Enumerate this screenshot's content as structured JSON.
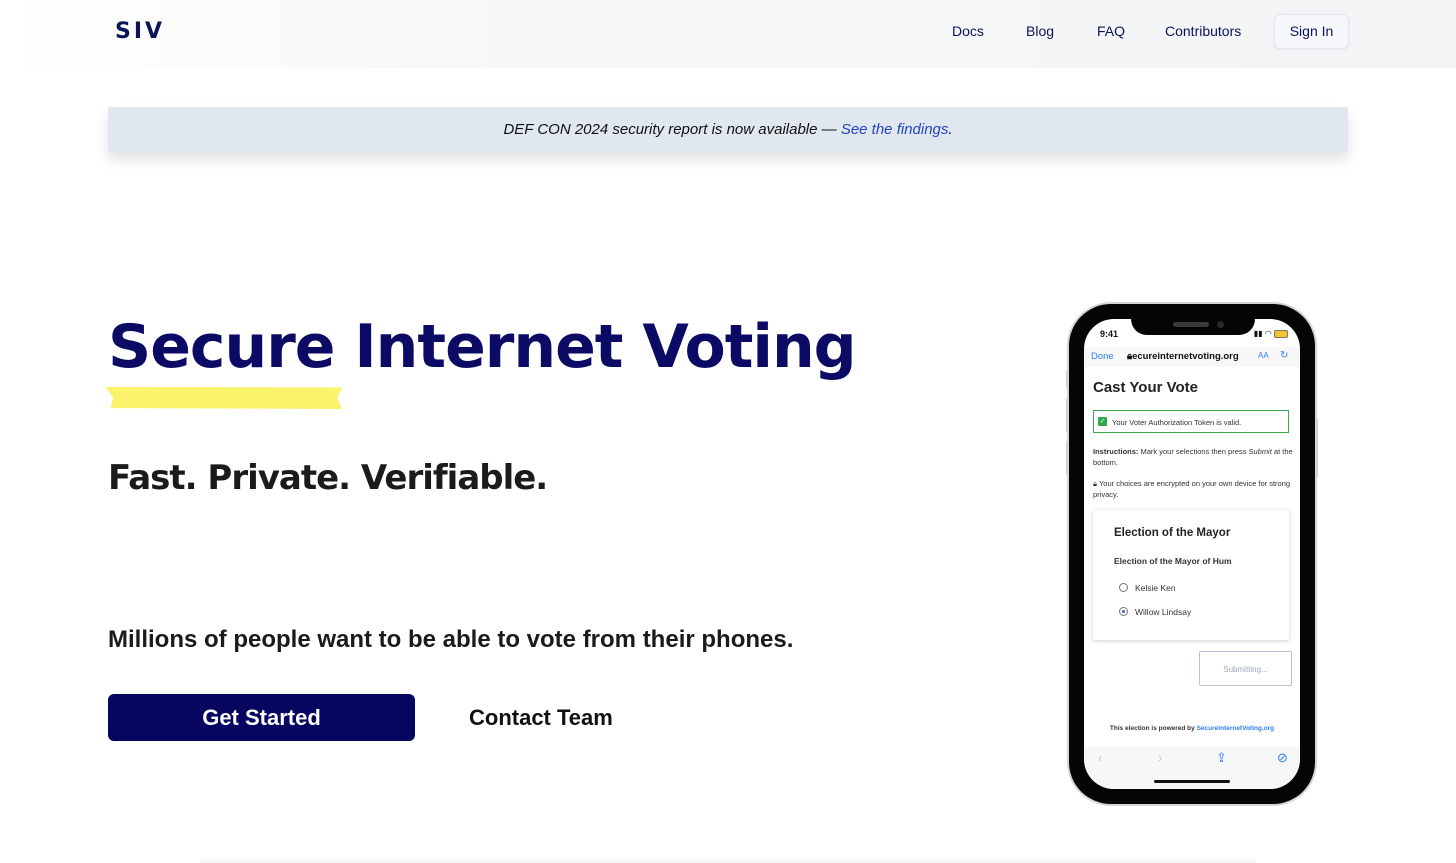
{
  "header": {
    "logo": "SIV",
    "nav": [
      "Docs",
      "Blog",
      "FAQ",
      "Contributors"
    ],
    "sign_in": "Sign In"
  },
  "banner": {
    "text": "DEF CON 2024 security report is now available — ",
    "link": "See the findings",
    "suffix": "."
  },
  "hero": {
    "title": "Secure Internet Voting",
    "tagline": "Fast. Private. Verifiable.",
    "lead": "Millions of people want to be able to vote from their phones.",
    "primary_cta": "Get Started",
    "secondary_cta": "Contact Team"
  },
  "phone": {
    "time": "9:41",
    "url_done": "Done",
    "url": "ecureinternetvoting.org",
    "url_aa": "AA",
    "heading": "Cast Your Vote",
    "token_status": "Your Voter Authorization Token is valid.",
    "instructions_label": "Instructions:",
    "instructions_text": " Mark your selections then press ",
    "instructions_submit": "Submit",
    "instructions_tail": " at the bottom.",
    "privacy_note": "Your choices are encrypted on your own device for strong privacy.",
    "card_title": "Election of the Mayor",
    "card_question": "Election of the Mayor of Hum",
    "options": [
      "Kelsie Ken",
      "Willow Lindsay"
    ],
    "selected_option": "Willow Lindsay",
    "submit_label": "Submitting...",
    "powered_by": "This election is powered by ",
    "powered_link": "SecureInternetVoting.org"
  },
  "colors": {
    "brand_navy": "#0b0b66",
    "button_navy": "#060660",
    "highlight_yellow": "#fbf36b",
    "banner_bg": "#e1e7ef",
    "link_blue": "#1f46c0"
  }
}
